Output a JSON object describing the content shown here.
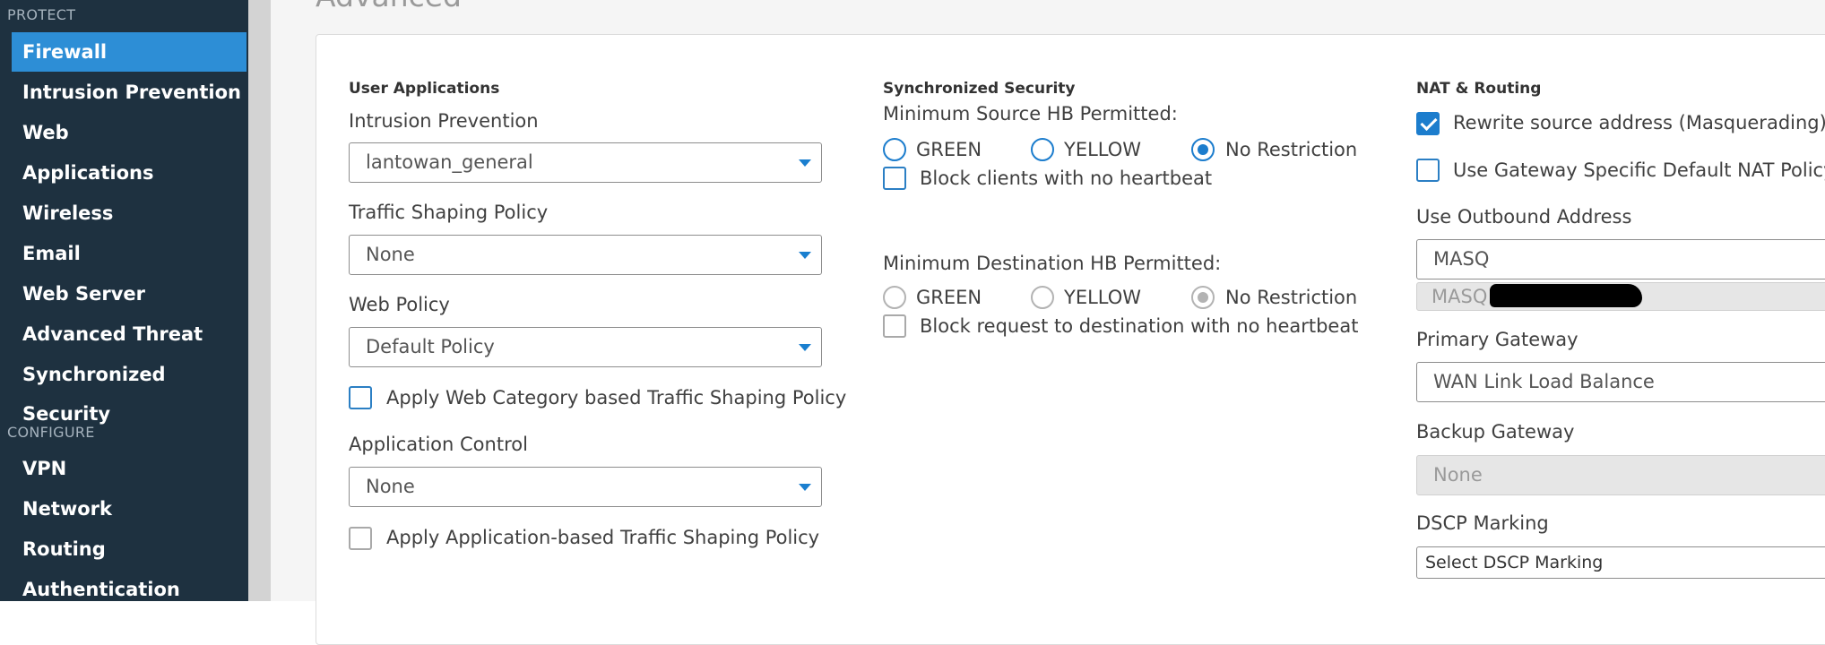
{
  "sidebar": {
    "protect_header": "PROTECT",
    "protect_items": [
      "Firewall",
      "Intrusion Prevention",
      "Web",
      "Applications",
      "Wireless",
      "Email",
      "Web Server",
      "Advanced Threat",
      "Synchronized Security"
    ],
    "configure_header": "CONFIGURE",
    "configure_items": [
      "VPN",
      "Network",
      "Routing",
      "Authentication"
    ],
    "active_item": "Firewall"
  },
  "page": {
    "title": "Advanced"
  },
  "user_apps": {
    "title": "User Applications",
    "ips_label": "Intrusion Prevention",
    "ips_value": "lantowan_general",
    "traffic_label": "Traffic Shaping Policy",
    "traffic_value": "None",
    "web_label": "Web Policy",
    "web_value": "Default Policy",
    "web_shaping_label": "Apply Web Category based Traffic Shaping Policy",
    "app_label": "Application Control",
    "app_value": "None",
    "app_shaping_label": "Apply Application-based Traffic Shaping Policy"
  },
  "sync": {
    "title": "Synchronized Security",
    "src_label": "Minimum Source HB Permitted:",
    "src_options": [
      "GREEN",
      "YELLOW",
      "No Restriction"
    ],
    "src_selected": "No Restriction",
    "block_clients_label": "Block clients with no heartbeat",
    "dst_label": "Minimum Destination HB Permitted:",
    "dst_options": [
      "GREEN",
      "YELLOW",
      "No Restriction"
    ],
    "dst_selected": "No Restriction",
    "block_dest_label": "Block request to destination with no heartbeat"
  },
  "nat": {
    "title": "NAT & Routing",
    "rewrite_label": "Rewrite source address (Masquerading)",
    "rewrite_checked": true,
    "gateway_nat_label": "Use Gateway Specific Default NAT Policy",
    "gateway_nat_checked": false,
    "outbound_label": "Use Outbound Address",
    "outbound_value": "MASQ",
    "outbound_sub": "MASQ",
    "primary_label": "Primary Gateway",
    "primary_value": "WAN Link Load Balance",
    "backup_label": "Backup Gateway",
    "backup_value": "None",
    "dscp_label": "DSCP Marking",
    "dscp_value": "Select DSCP Marking"
  },
  "colors": {
    "sidebar_bg": "#1e3140",
    "accent": "#2d8ed6",
    "check_blue": "#1c7dcd"
  }
}
